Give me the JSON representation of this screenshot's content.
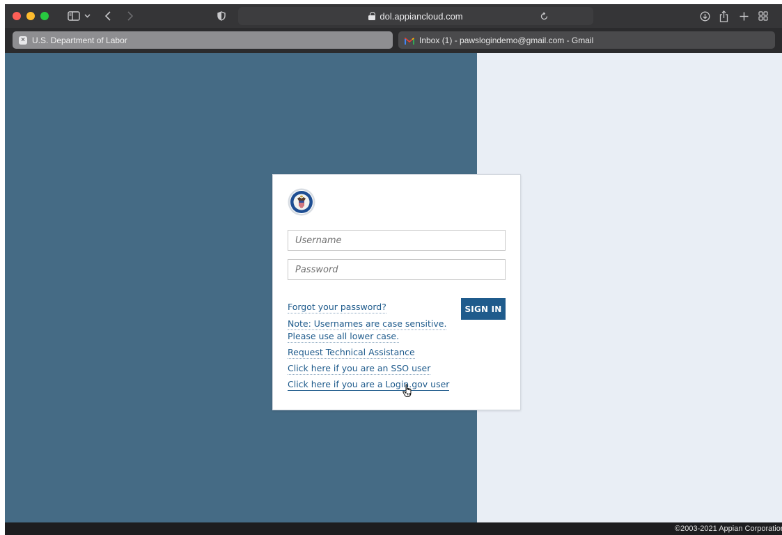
{
  "browser": {
    "address": "dol.appiancloud.com",
    "tabs": [
      {
        "label": "U.S. Department of Labor",
        "active": true
      },
      {
        "label": "Inbox (1) - pawslogindemo@gmail.com - Gmail",
        "active": false
      }
    ]
  },
  "login": {
    "username_placeholder": "Username",
    "password_placeholder": "Password",
    "sign_in_label": "SIGN IN",
    "links": {
      "forgot": "Forgot your password?",
      "note_line1": "Note: Usernames are case sensitive.",
      "note_line2": "Please use all lower case.",
      "assistance": "Request Technical Assistance",
      "sso": "Click here if you are an SSO user",
      "logingov": "Click here if you are a Login.gov user"
    }
  },
  "footer": {
    "copyright": "©2003-2021 Appian Corporation"
  },
  "colors": {
    "left_panel": "#456b85",
    "right_panel": "#e9eef5",
    "primary_button": "#1f5b8c",
    "link": "#1f5b8c"
  },
  "icons": {
    "window_controls": [
      "close-icon",
      "minimize-icon",
      "maximize-icon"
    ],
    "toolbar_left": [
      "sidebar-icon",
      "chevron-down-icon",
      "back-icon",
      "forward-icon",
      "shield-icon"
    ],
    "toolbar_right": [
      "reload-icon",
      "download-icon",
      "share-icon",
      "new-tab-icon",
      "tab-overview-icon"
    ]
  }
}
